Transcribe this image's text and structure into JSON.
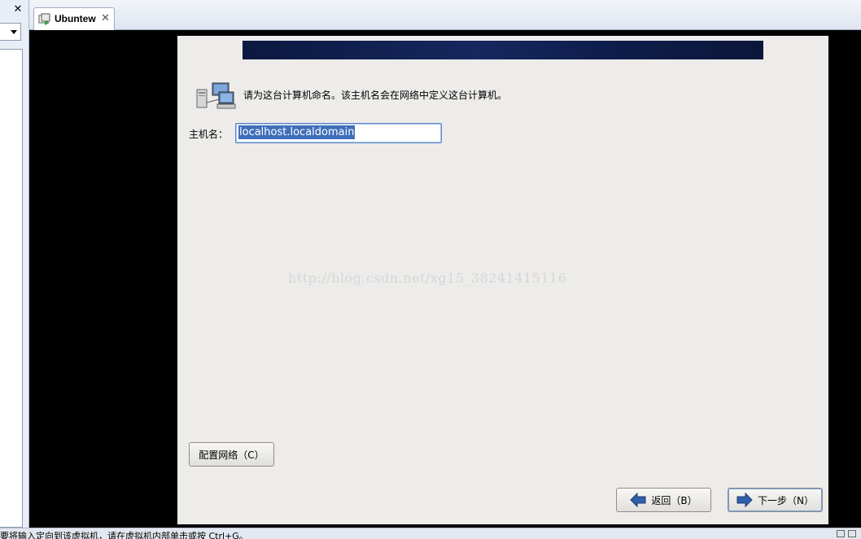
{
  "host": {
    "close_glyph": "✕",
    "tab": {
      "label": "Ubuntew",
      "close_glyph": "✕",
      "icon": "vm-icon"
    },
    "status_text": "要将输入定向到该虚拟机，请在虚拟机内部单击或按 Ctrl+G。"
  },
  "installer": {
    "intro": "请为这台计算机命名。该主机名会在网络中定义这台计算机。",
    "hostname_label": "主机名：",
    "hostname_value": "localhost.localdomain",
    "watermark": "http://blog.csdn.net/xg15_38241415116",
    "configure_network_button": "配置网络（C）",
    "back_button": "返回（B）",
    "next_button": "下一步（N）"
  },
  "colors": {
    "banner": "#0e1d4c",
    "installer_bg": "#edecea",
    "selection": "#3f6fbb"
  }
}
